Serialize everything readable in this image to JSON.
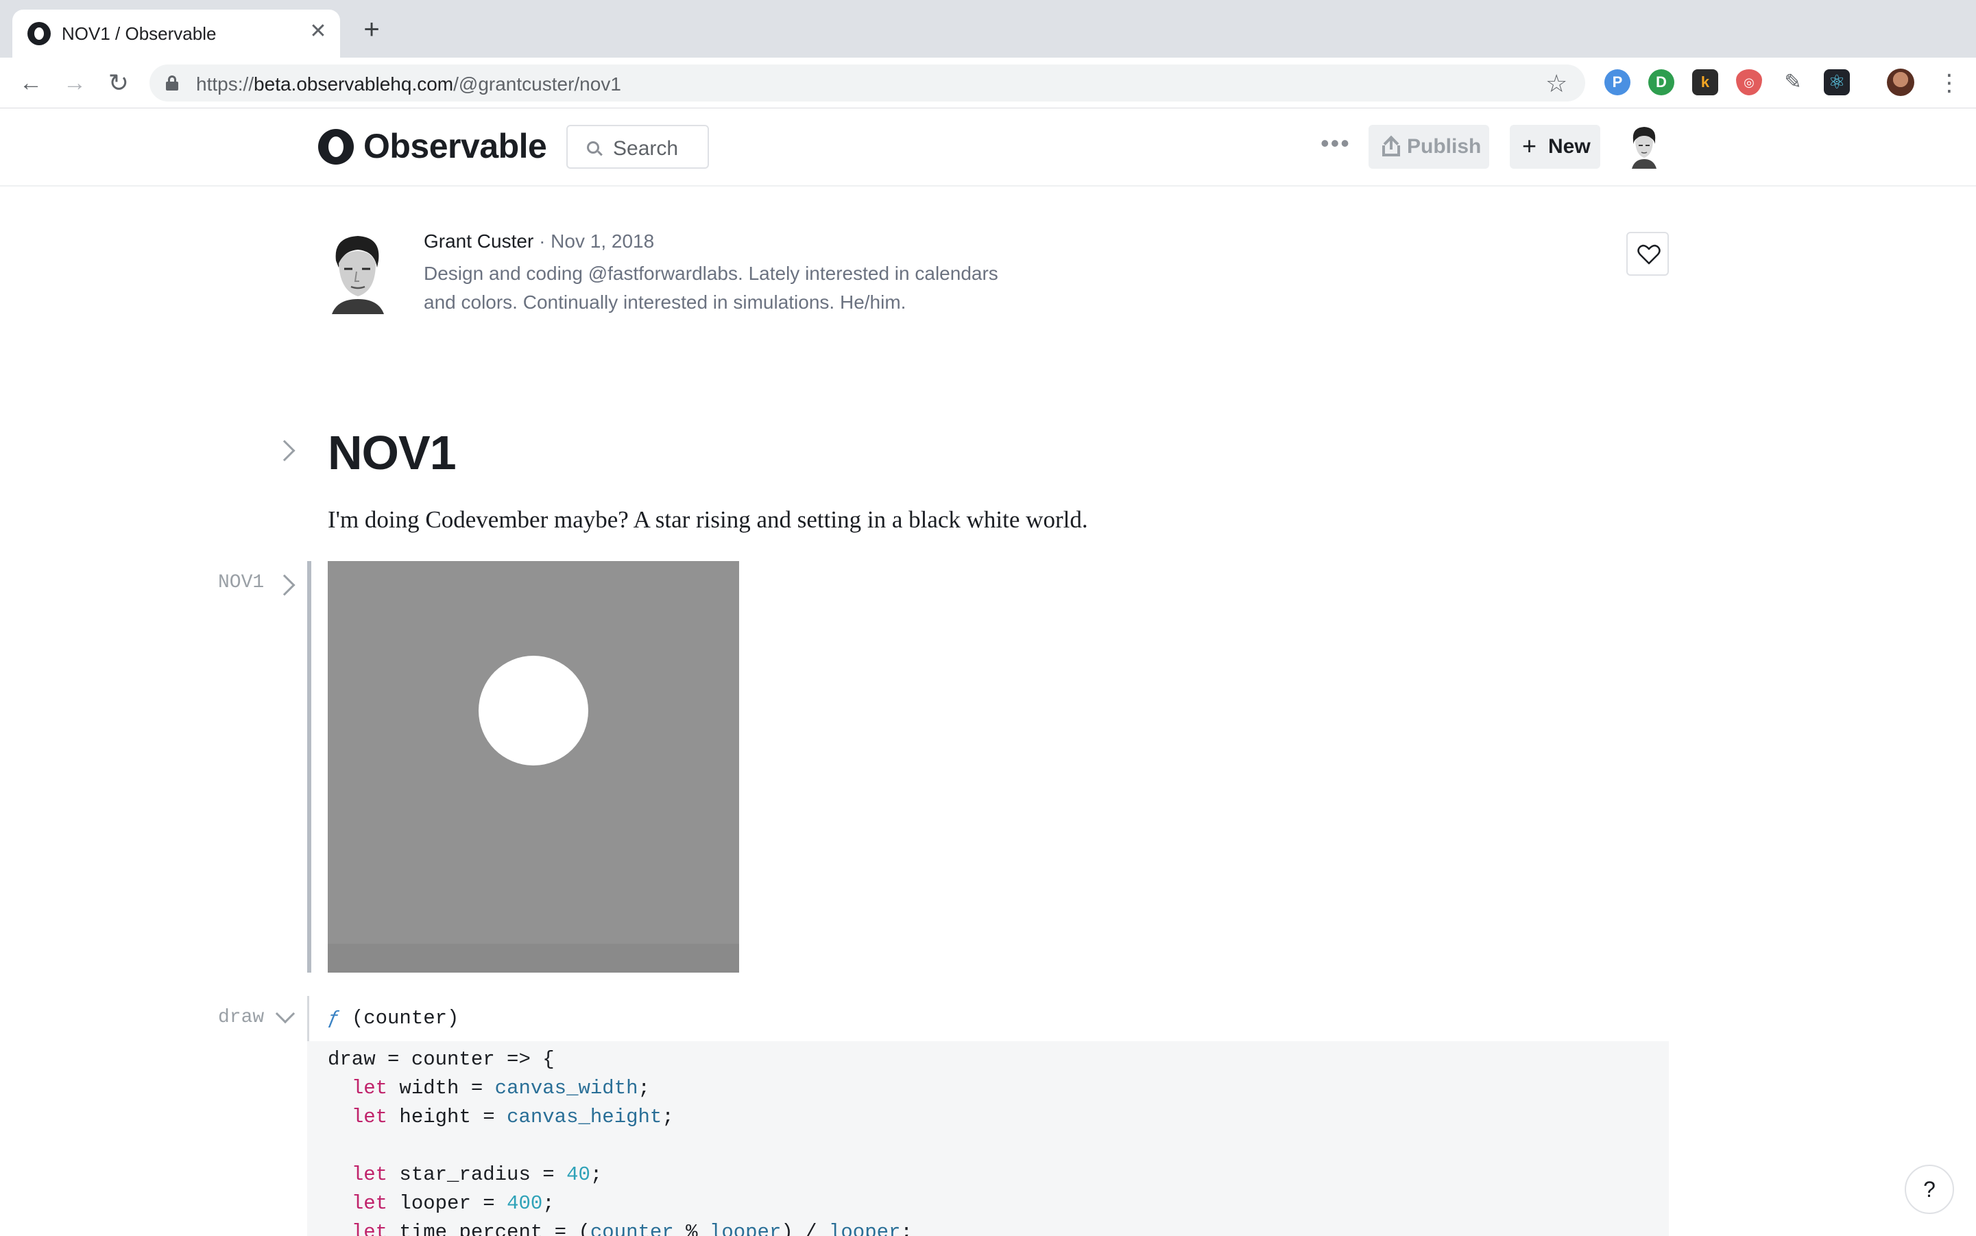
{
  "browser": {
    "tab_title": "NOV1 / Observable",
    "url_scheme": "https://",
    "url_host": "beta.observablehq.com",
    "url_path": "/@grantcuster/nov1",
    "extensions": [
      "pinboard-icon",
      "instapaper-icon",
      "kindle-icon",
      "privacy-badger-icon",
      "pin-icon",
      "react-devtools-icon"
    ]
  },
  "header": {
    "brand": "Observable",
    "search_label": "Search",
    "publish_label": "Publish",
    "new_label": "New"
  },
  "author": {
    "name": "Grant Custer",
    "separator": "·",
    "date": "Nov 1, 2018",
    "bio_line1": "Design and coding @fastforwardlabs. Lately interested in calendars",
    "bio_line2": "and colors. Continually interested in simulations. He/him."
  },
  "notebook": {
    "title": "NOV1",
    "description": "I'm doing Codevember maybe? A star rising and setting in a black white world.",
    "cells": [
      {
        "name": "NOV1"
      },
      {
        "name": "draw",
        "signature_fn": "ƒ",
        "signature_args": "(counter)",
        "code": [
          {
            "parts": [
              [
                "t",
                "draw = counter => {"
              ]
            ]
          },
          {
            "parts": [
              [
                "t",
                "  "
              ],
              [
                "kw",
                "let"
              ],
              [
                "t",
                " width = "
              ],
              [
                "vr",
                "canvas_width"
              ],
              [
                "t",
                ";"
              ]
            ]
          },
          {
            "parts": [
              [
                "t",
                "  "
              ],
              [
                "kw",
                "let"
              ],
              [
                "t",
                " height = "
              ],
              [
                "vr",
                "canvas_height"
              ],
              [
                "t",
                ";"
              ]
            ]
          },
          {
            "parts": [
              [
                "t",
                ""
              ]
            ]
          },
          {
            "parts": [
              [
                "t",
                "  "
              ],
              [
                "kw",
                "let"
              ],
              [
                "t",
                " star_radius = "
              ],
              [
                "nm",
                "40"
              ],
              [
                "t",
                ";"
              ]
            ]
          },
          {
            "parts": [
              [
                "t",
                "  "
              ],
              [
                "kw",
                "let"
              ],
              [
                "t",
                " looper = "
              ],
              [
                "nm",
                "400"
              ],
              [
                "t",
                ";"
              ]
            ]
          },
          {
            "parts": [
              [
                "t",
                "  "
              ],
              [
                "kw",
                "let"
              ],
              [
                "t",
                " time_percent = ("
              ],
              [
                "vr",
                "counter"
              ],
              [
                "t",
                " % "
              ],
              [
                "vr",
                "looper"
              ],
              [
                "t",
                ") / "
              ],
              [
                "vr",
                "looper"
              ],
              [
                "t",
                ";"
              ]
            ]
          }
        ]
      }
    ]
  },
  "help_label": "?"
}
